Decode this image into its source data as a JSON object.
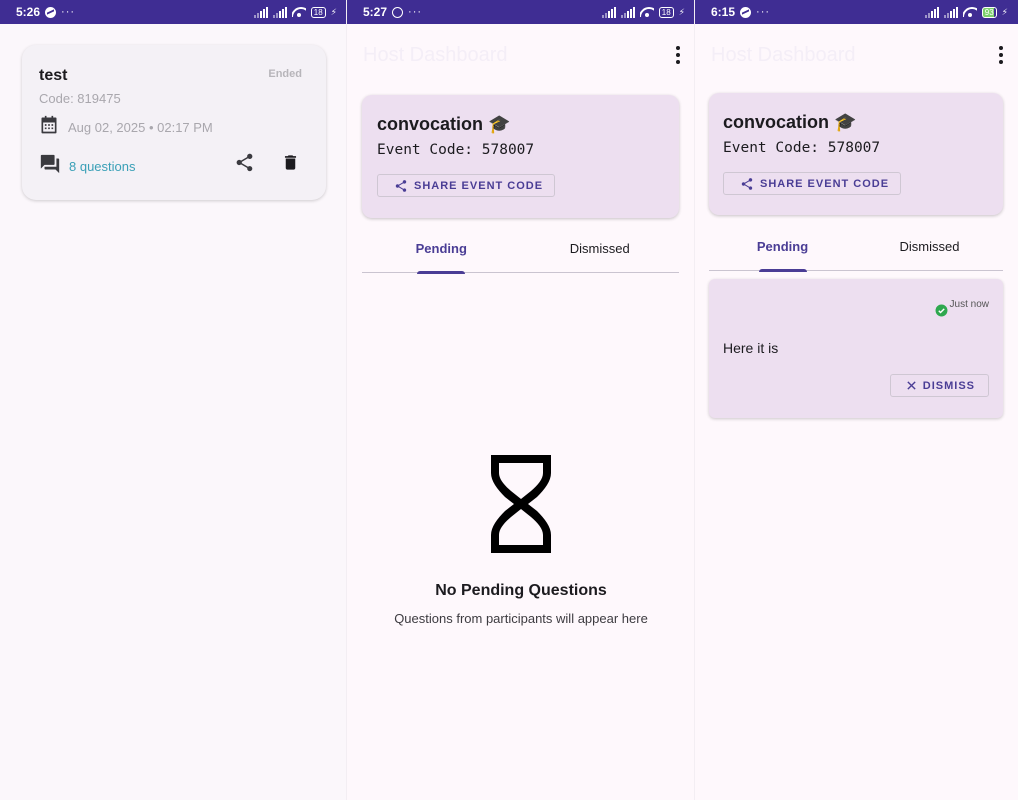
{
  "colors": {
    "status_bar": "#3f2d93",
    "accent": "#4a3d95",
    "card_bg": "#eddff0",
    "link": "#3aa0b7",
    "success": "#2fa84f"
  },
  "screen1": {
    "status": {
      "time": "5:26",
      "dots": "···",
      "battery": "18",
      "app_icon": "messenger-icon"
    },
    "event_card": {
      "title": "test",
      "status": "Ended",
      "code": "Code: 819475",
      "date": "Aug 02, 2025 • 02:17 PM",
      "questions": "8 questions"
    }
  },
  "screen2": {
    "status": {
      "time": "5:27",
      "dots": "···",
      "battery": "18",
      "app_icon": "whatsapp-icon"
    },
    "appbar": {
      "title": "Host Dashboard"
    },
    "event": {
      "name": "convocation 🎓",
      "code": "Event Code: 578007",
      "share_label": "SHARE EVENT CODE"
    },
    "tabs": [
      {
        "label": "Pending"
      },
      {
        "label": "Dismissed"
      }
    ],
    "empty": {
      "title": "No Pending Questions",
      "subtitle": "Questions from participants will appear here"
    }
  },
  "screen3": {
    "status": {
      "time": "6:15",
      "dots": "···",
      "battery": "93",
      "app_icon": "messenger-icon"
    },
    "appbar": {
      "title": "Host Dashboard"
    },
    "event": {
      "name": "convocation 🎓",
      "code": "Event Code: 578007",
      "share_label": "SHARE EVENT CODE"
    },
    "tabs": [
      {
        "label": "Pending"
      },
      {
        "label": "Dismissed"
      }
    ],
    "question": {
      "time": "Just now",
      "text": "Here it is",
      "dismiss_label": "DISMISS"
    }
  }
}
